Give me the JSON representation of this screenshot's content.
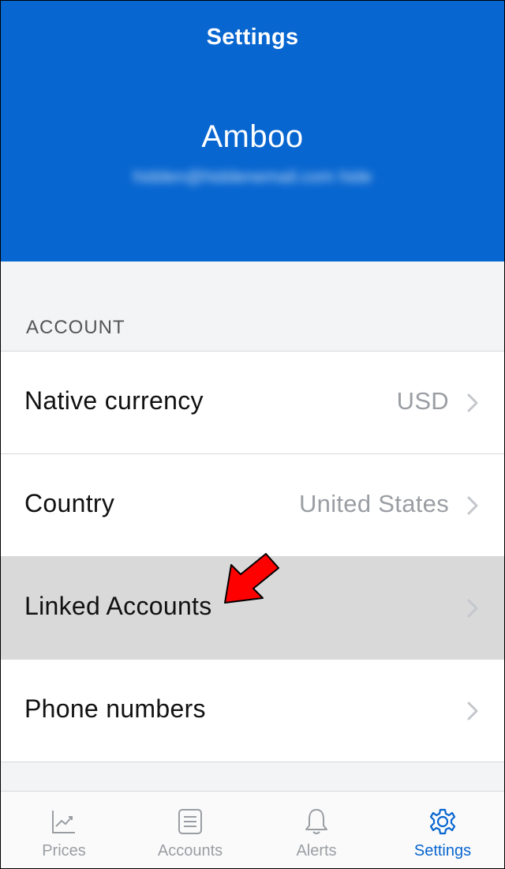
{
  "header": {
    "title": "Settings",
    "profile_name": "Amboo",
    "profile_email": "hidden@hiddenemail.com hide"
  },
  "sections": [
    {
      "label": "ACCOUNT",
      "rows": [
        {
          "label": "Native currency",
          "value": "USD",
          "highlighted": false
        },
        {
          "label": "Country",
          "value": "United States",
          "highlighted": false
        },
        {
          "label": "Linked Accounts",
          "value": "",
          "highlighted": true
        },
        {
          "label": "Phone numbers",
          "value": "",
          "highlighted": false
        }
      ]
    }
  ],
  "tabbar": {
    "tabs": [
      {
        "label": "Prices",
        "icon": "chart-icon",
        "active": false
      },
      {
        "label": "Accounts",
        "icon": "list-icon",
        "active": false
      },
      {
        "label": "Alerts",
        "icon": "bell-icon",
        "active": false
      },
      {
        "label": "Settings",
        "icon": "gear-icon",
        "active": true
      }
    ]
  },
  "colors": {
    "brand_blue": "#0866d0",
    "highlight_gray": "#d9d9d9",
    "annotation_red": "#ff0000"
  }
}
